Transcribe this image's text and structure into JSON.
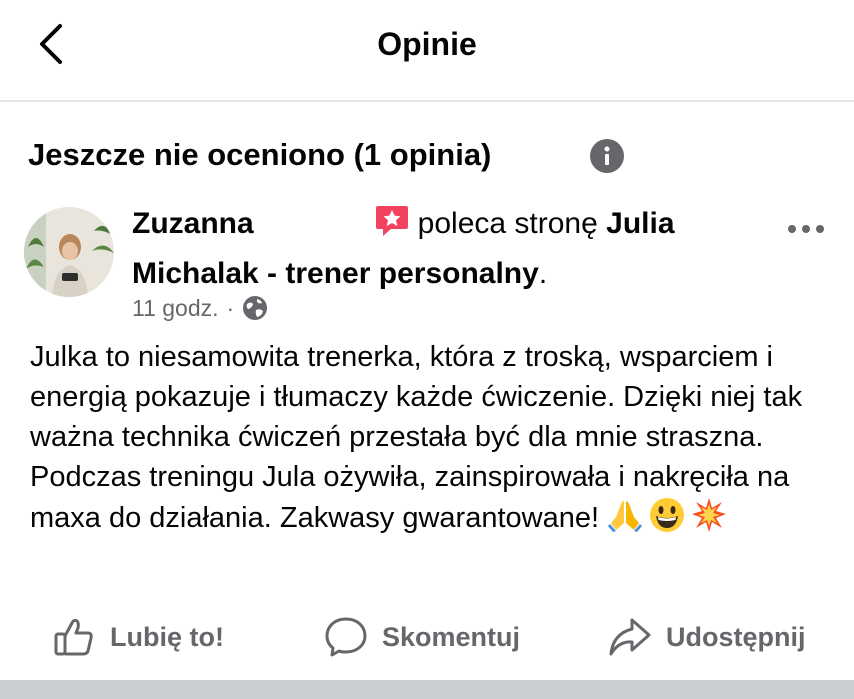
{
  "header": {
    "title": "Opinie",
    "back_icon": "chevron-left-icon"
  },
  "section": {
    "title": "Jeszcze nie oceniono (1 opinia)",
    "info_icon": "info-icon"
  },
  "review": {
    "author": "Zuzanna",
    "action_text": "poleca stronę",
    "page_name": "Julia Michalak - trener personalny",
    "period": ".",
    "timestamp": "11 godz.",
    "separator": "·",
    "privacy_icon": "globe-icon",
    "body": "Julka to niesamowita trenerka, która z troską, wsparciem i energią pokazuje i tłumaczy każde ćwiczenie. Dzięki niej tak ważna technika ćwiczeń przestała być dla mnie straszna. Podczas treningu Jula ożywiła, zainspirowała i nakręciła na maxa do działania. Zakwasy gwarantowane!",
    "emojis": [
      "folded-hands-emoji",
      "grinning-face-emoji",
      "collision-emoji"
    ]
  },
  "actions": {
    "like": "Lubię to!",
    "comment": "Skomentuj",
    "share": "Udostępnij"
  },
  "colors": {
    "text": "#050505",
    "secondary": "#65676b",
    "recommend": "#f3425f",
    "divider": "#e4e6eb"
  }
}
